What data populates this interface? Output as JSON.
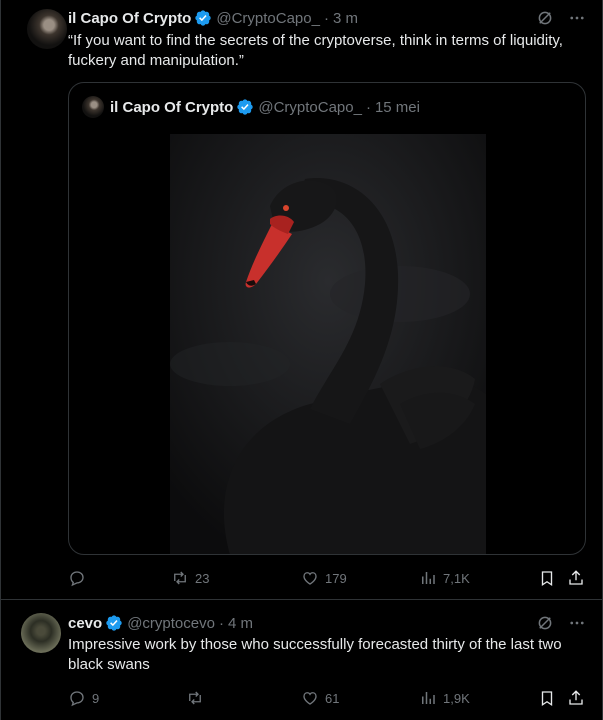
{
  "main_tweet": {
    "author_name": "il Capo Of Crypto",
    "handle": "@CryptoCapo_",
    "separator": "·",
    "time": "3 m",
    "text": "“If you want to find the secrets of the cryptoverse, think in terms of liquidity, fuckery and manipulation.”",
    "quoted": {
      "author_name": "il Capo Of Crypto",
      "handle": "@CryptoCapo_",
      "separator": "·",
      "date": "15 mei",
      "image_subject": "black swan"
    },
    "stats": {
      "replies": "",
      "reposts": "23",
      "likes": "179",
      "views": "7,1K"
    }
  },
  "reply_tweet": {
    "author_name": "cevo",
    "handle": "@cryptocevo",
    "separator": "·",
    "time": "4 m",
    "text": "Impressive work by those who successfully forecasted thirty of the last two black swans",
    "stats": {
      "replies": "9",
      "reposts": "",
      "likes": "61",
      "views": "1,9K"
    }
  },
  "icons": {
    "verified": "verified-badge-icon",
    "grok": "grok-icon",
    "more": "more-icon",
    "reply": "reply-icon",
    "repost": "repost-icon",
    "like": "like-icon",
    "views": "views-icon",
    "bookmark": "bookmark-icon",
    "share": "share-icon"
  },
  "colors": {
    "background": "#000000",
    "text": "#e7e9ea",
    "muted": "#71767b",
    "border": "#2f3336",
    "verified": "#1d9bf0"
  }
}
